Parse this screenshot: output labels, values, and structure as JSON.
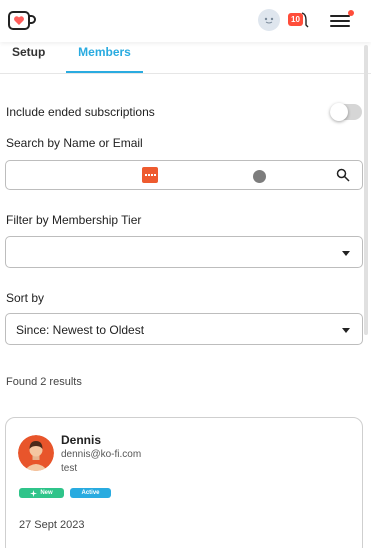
{
  "header": {
    "logo_icon": "ko-fi-cup-heart-icon",
    "avatar_icon": "ghost-avatar-icon",
    "notification_count": "10",
    "menu_icon": "hamburger-icon",
    "accent": "#29abe0",
    "alert": "#ff4d3a"
  },
  "tabs": [
    {
      "label": "Setup",
      "active": false
    },
    {
      "label": "Members",
      "active": true
    }
  ],
  "filters": {
    "include_ended_label": "Include ended subscriptions",
    "include_ended_on": false,
    "search_label": "Search by Name or Email",
    "search_value": "",
    "tier_label": "Filter by Membership Tier",
    "tier_value": "",
    "sort_label": "Sort by",
    "sort_value": "Since: Newest to Oldest"
  },
  "results_text": "Found 2 results",
  "members": [
    {
      "name": "Dennis",
      "email": "dennis@ko-fi.com",
      "note": "test",
      "badges": [
        {
          "label": "New",
          "color": "#2fc48a"
        },
        {
          "label": "Active",
          "color": "#29abe0"
        }
      ],
      "date": "27 Sept 2023"
    }
  ]
}
